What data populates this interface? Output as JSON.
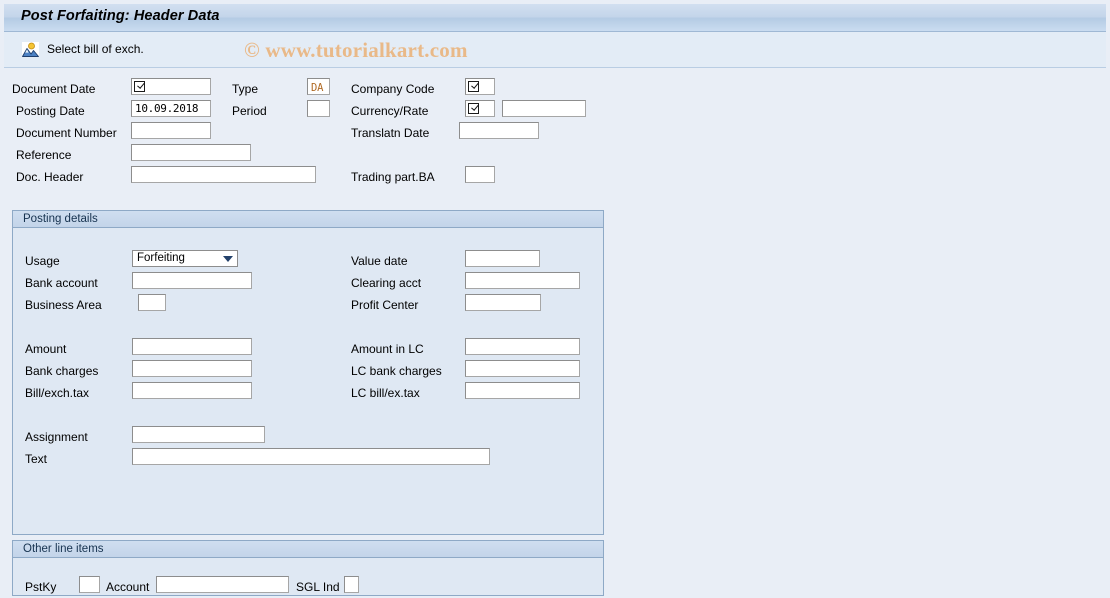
{
  "window": {
    "title": "Post Forfaiting: Header Data"
  },
  "toolbar": {
    "select_bill_label": "Select bill of exch.",
    "select_bill_icon": "picture-icon"
  },
  "watermark": {
    "text": "© www.tutorialkart.com",
    "color": "#e9b988"
  },
  "header_form": {
    "left": [
      {
        "label": "Document Date",
        "value": "",
        "required": true
      },
      {
        "label": "Posting Date",
        "value": "10.09.2018",
        "required": false
      },
      {
        "label": "Document Number",
        "value": "",
        "required": false
      },
      {
        "label": "Reference",
        "value": "",
        "required": false
      },
      {
        "label": "Doc. Header",
        "value": "",
        "required": false
      }
    ],
    "middle": [
      {
        "label": "Type",
        "value": "DA",
        "required": false
      },
      {
        "label": "Period",
        "value": "",
        "required": false
      }
    ],
    "right": [
      {
        "label": "Company Code",
        "value": "",
        "required": true
      },
      {
        "label": "Currency/Rate",
        "value": "",
        "rate_value": "",
        "required": true
      },
      {
        "label": "Translatn Date",
        "value": "",
        "required": false
      },
      {
        "label": "Trading part.BA",
        "value": "",
        "required": false
      }
    ]
  },
  "posting_details": {
    "title": "Posting details",
    "usage": {
      "label": "Usage",
      "selected": "Forfeiting",
      "options": [
        "Forfeiting"
      ]
    },
    "left_fields": [
      {
        "label": "Bank account",
        "value": ""
      },
      {
        "label": "Business Area",
        "value": ""
      },
      {
        "label": "Amount",
        "value": ""
      },
      {
        "label": "Bank charges",
        "value": ""
      },
      {
        "label": "Bill/exch.tax",
        "value": ""
      },
      {
        "label": "Assignment",
        "value": ""
      },
      {
        "label": "Text",
        "value": ""
      }
    ],
    "right_fields": [
      {
        "label": "Value date",
        "value": ""
      },
      {
        "label": "Clearing acct",
        "value": ""
      },
      {
        "label": "Profit Center",
        "value": ""
      },
      {
        "label": "Amount in LC",
        "value": ""
      },
      {
        "label": "LC bank charges",
        "value": ""
      },
      {
        "label": "LC bill/ex.tax",
        "value": ""
      }
    ]
  },
  "other_line_items": {
    "title": "Other line items",
    "pstky": {
      "label": "PstKy",
      "value": ""
    },
    "account": {
      "label": "Account",
      "value": ""
    },
    "sgl_ind": {
      "label": "SGL Ind",
      "value": ""
    }
  },
  "colors": {
    "background": "#e9eef6",
    "group_bg": "#dfe8f3",
    "group_border": "#8ea9c6",
    "titlebar": "#c3d5ea",
    "watermark": "#e9b988",
    "code_text": "#b06a24"
  }
}
